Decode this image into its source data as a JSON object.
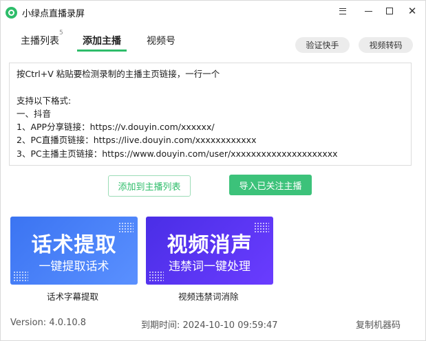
{
  "window": {
    "title": "小绿点直播录屏",
    "accent_color": "#2ebd6a"
  },
  "tabs": [
    {
      "label": "主播列表",
      "badge": "5"
    },
    {
      "label": "添加主播"
    },
    {
      "label": "视频号"
    }
  ],
  "toolbar": {
    "verify_label": "验证快手",
    "convert_label": "视频转码"
  },
  "editor": {
    "lines": [
      "按Ctrl+V 粘贴要检测录制的主播主页链接，一行一个",
      "",
      "支持以下格式:",
      "一、抖音",
      "1、APP分享链接：https://v.douyin.com/xxxxxx/",
      "2、PC直播页链接：https://live.douyin.com/xxxxxxxxxxxx",
      "3、PC主播主页链接：https://www.douyin.com/user/xxxxxxxxxxxxxxxxxxxxx"
    ]
  },
  "actions": {
    "add_to_list_label": "添加到主播列表",
    "import_followed_label": "导入已关注主播"
  },
  "banners": [
    {
      "title": "话术提取",
      "subtitle": "一键提取话术",
      "caption": "话术字幕提取"
    },
    {
      "title": "视频消声",
      "subtitle": "违禁词一键处理",
      "caption": "视频违禁词消除"
    }
  ],
  "footer": {
    "version": "Version:  4.0.10.8",
    "expire": "到期时间:  2024-10-10 09:59:47",
    "copy_code_label": "复制机器码"
  }
}
